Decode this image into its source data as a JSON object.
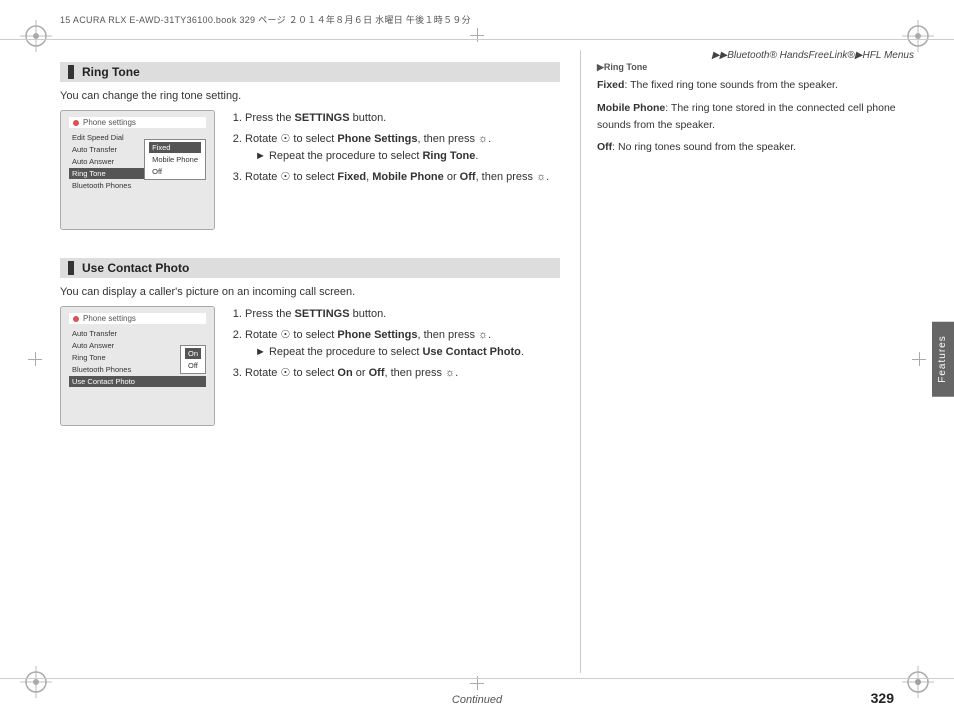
{
  "header": {
    "file_info": "15 ACURA RLX E-AWD-31TY36100.book  329 ページ  ２０１４年８月６日  水曜日  午後１時５９分"
  },
  "breadcrumb": {
    "text": "▶▶Bluetooth® HandsFreeLink®▶HFL Menus"
  },
  "page_number": "329",
  "continued": "Continued",
  "sidebar_label": "Features",
  "ring_tone_section": {
    "heading": "Ring Tone",
    "description": "You can change the ring tone setting.",
    "screen1": {
      "title": "Phone settings",
      "menu_items": [
        "Edit Speed Dial",
        "Auto Transfer",
        "Auto Answer",
        "Ring Tone",
        "Bluetooth Phones"
      ],
      "active_item": "Ring Tone",
      "sub_items": [
        "Fixed",
        "Mobile Phone",
        "Off"
      ],
      "highlighted_sub": "Fixed"
    },
    "instructions": [
      {
        "step": "1",
        "text": "Press the SETTINGS button."
      },
      {
        "step": "2",
        "text": "Rotate  to select Phone Settings, then press ."
      },
      {
        "arrow_step": "Repeat the procedure to select Ring Tone."
      },
      {
        "step": "3",
        "text": "Rotate  to select Fixed, Mobile Phone or Off, then press ."
      }
    ]
  },
  "use_contact_photo_section": {
    "heading": "Use Contact Photo",
    "description": "You can display a caller's picture on an incoming call screen.",
    "screen2": {
      "title": "Phone settings",
      "menu_items": [
        "Auto Transfer",
        "Auto Answer",
        "Ring Tone",
        "Bluetooth Phones",
        "Use Contact Photo"
      ],
      "active_item": "Use Contact Photo",
      "sub_items": [
        "On",
        "Off"
      ],
      "highlighted_sub": "On"
    },
    "instructions": [
      {
        "step": "1",
        "text": "Press the SETTINGS button."
      },
      {
        "step": "2",
        "text": "Rotate  to select Phone Settings, then press ."
      },
      {
        "arrow_step": "Repeat the procedure to select Use Contact Photo."
      },
      {
        "step": "3",
        "text": "Rotate  to select On or Off, then press ."
      }
    ]
  },
  "right_note": {
    "label": "▶Ring Tone",
    "fixed": "Fixed: The fixed ring tone sounds from the speaker.",
    "mobile_phone": "Mobile Phone: The ring tone stored in the connected cell phone sounds from the speaker.",
    "off": "Off: No ring tones sound from the speaker."
  }
}
